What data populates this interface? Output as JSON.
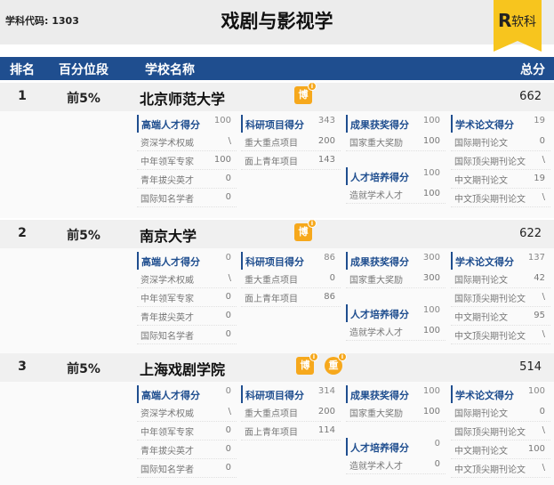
{
  "header": {
    "code_label": "学科代码: 1303",
    "title": "戏剧与影视学",
    "logo_text": "软科"
  },
  "table_head": {
    "rank": "排名",
    "percentile": "百分位段",
    "school": "学校名称",
    "score": "总分"
  },
  "schools": [
    {
      "rank": "1",
      "percentile": "前5%",
      "name": "北京师范大学",
      "score": "662",
      "badges": [
        "博"
      ],
      "talent": {
        "label": "高端人才得分",
        "value": "100",
        "items": [
          [
            "资深学术权威",
            "\\"
          ],
          [
            "中年领军专家",
            "100"
          ],
          [
            "青年拔尖英才",
            "0"
          ],
          [
            "国际知名学者",
            "0"
          ]
        ]
      },
      "research": {
        "label": "科研项目得分",
        "value": "343",
        "items": [
          [
            "重大重点项目",
            "200"
          ],
          [
            "面上青年项目",
            "143"
          ]
        ]
      },
      "award": {
        "label": "成果获奖得分",
        "value": "100",
        "items": [
          [
            "国家重大奖励",
            "100"
          ]
        ]
      },
      "training": {
        "label": "人才培养得分",
        "value": "100",
        "items": [
          [
            "造就学术人才",
            "100"
          ]
        ]
      },
      "paper": {
        "label": "学术论文得分",
        "value": "19",
        "items": [
          [
            "国际期刊论文",
            "0"
          ],
          [
            "国际顶尖期刊论文",
            "\\"
          ],
          [
            "中文期刊论文",
            "19"
          ],
          [
            "中文顶尖期刊论文",
            "\\"
          ]
        ]
      }
    },
    {
      "rank": "2",
      "percentile": "前5%",
      "name": "南京大学",
      "score": "622",
      "badges": [
        "博"
      ],
      "talent": {
        "label": "高端人才得分",
        "value": "0",
        "items": [
          [
            "资深学术权威",
            "\\"
          ],
          [
            "中年领军专家",
            "0"
          ],
          [
            "青年拔尖英才",
            "0"
          ],
          [
            "国际知名学者",
            "0"
          ]
        ]
      },
      "research": {
        "label": "科研项目得分",
        "value": "86",
        "items": [
          [
            "重大重点项目",
            "0"
          ],
          [
            "面上青年项目",
            "86"
          ]
        ]
      },
      "award": {
        "label": "成果获奖得分",
        "value": "300",
        "items": [
          [
            "国家重大奖励",
            "300"
          ]
        ]
      },
      "training": {
        "label": "人才培养得分",
        "value": "100",
        "items": [
          [
            "造就学术人才",
            "100"
          ]
        ]
      },
      "paper": {
        "label": "学术论文得分",
        "value": "137",
        "items": [
          [
            "国际期刊论文",
            "42"
          ],
          [
            "国际顶尖期刊论文",
            "\\"
          ],
          [
            "中文期刊论文",
            "95"
          ],
          [
            "中文顶尖期刊论文",
            "\\"
          ]
        ]
      }
    },
    {
      "rank": "3",
      "percentile": "前5%",
      "name": "上海戏剧学院",
      "score": "514",
      "badges": [
        "博",
        "重"
      ],
      "talent": {
        "label": "高端人才得分",
        "value": "0",
        "items": [
          [
            "资深学术权威",
            "\\"
          ],
          [
            "中年领军专家",
            "0"
          ],
          [
            "青年拔尖英才",
            "0"
          ],
          [
            "国际知名学者",
            "0"
          ]
        ]
      },
      "research": {
        "label": "科研项目得分",
        "value": "314",
        "items": [
          [
            "重大重点项目",
            "200"
          ],
          [
            "面上青年项目",
            "114"
          ]
        ]
      },
      "award": {
        "label": "成果获奖得分",
        "value": "100",
        "items": [
          [
            "国家重大奖励",
            "100"
          ]
        ]
      },
      "training": {
        "label": "人才培养得分",
        "value": "0",
        "items": [
          [
            "造就学术人才",
            "0"
          ]
        ]
      },
      "paper": {
        "label": "学术论文得分",
        "value": "100",
        "items": [
          [
            "国际期刊论文",
            "0"
          ],
          [
            "国际顶尖期刊论文",
            "\\"
          ],
          [
            "中文期刊论文",
            "100"
          ],
          [
            "中文顶尖期刊论文",
            "\\"
          ]
        ]
      }
    }
  ]
}
